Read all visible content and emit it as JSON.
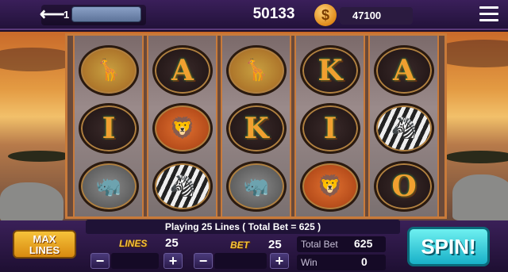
{
  "header": {
    "back_label": "1",
    "balance": "50133",
    "coin_symbol": "$",
    "coins": "47100"
  },
  "reels": [
    [
      "giraffe",
      "I",
      "rhino"
    ],
    [
      "A",
      "lion",
      "zebra"
    ],
    [
      "giraffe",
      "K",
      "rhino"
    ],
    [
      "K",
      "I",
      "lion"
    ],
    [
      "A",
      "zebra",
      "O"
    ]
  ],
  "info": {
    "playing_text": "Playing 25 Lines ( Total Bet = 625 )"
  },
  "controls": {
    "max_lines_line1": "MAX",
    "max_lines_line2": "LINES",
    "lines_label": "LINES",
    "lines_value": "25",
    "bet_label": "BET",
    "bet_value": "25",
    "minus": "−",
    "plus": "+",
    "total_bet_label": "Total Bet",
    "total_bet_value": "625",
    "win_label": "Win",
    "win_value": "0",
    "spin_label": "SPIN!"
  },
  "colors": {
    "accent_gold": "#f6c23a",
    "spin_cyan": "#18b0c8",
    "panel_purple": "#3a2058"
  }
}
